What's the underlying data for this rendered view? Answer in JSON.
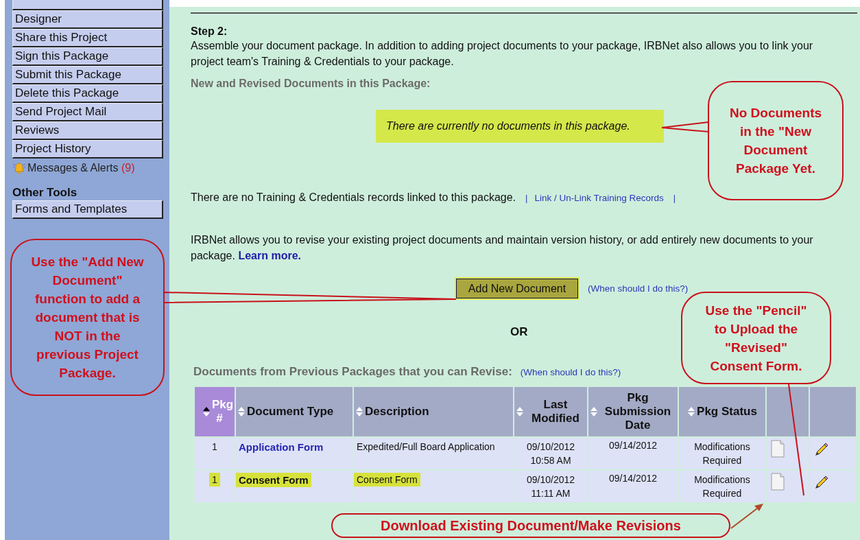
{
  "sidebar": {
    "items": [
      {
        "label": "Designer"
      },
      {
        "label": "Share this Project"
      },
      {
        "label": "Sign this Package"
      },
      {
        "label": "Submit this Package"
      },
      {
        "label": "Delete this Package"
      },
      {
        "label": "Send Project Mail"
      },
      {
        "label": "Reviews"
      },
      {
        "label": "Project History"
      }
    ],
    "messages": {
      "label": "Messages & Alerts",
      "count": "(9)"
    },
    "other_tools": {
      "heading": "Other Tools",
      "items": [
        {
          "label": "Forms and Templates"
        }
      ]
    }
  },
  "main": {
    "step_title": "Step 2:",
    "intro": "Assemble your document package. In addition to adding project documents to your package, IRBNet also allows you to link your project team's Training & Credentials to your package.",
    "new_docs_heading": "New and Revised Documents in this Package:",
    "empty_message": "There are currently no documents in this package.",
    "training_text": "There are no Training & Credentials records linked to this package.",
    "training_separators": [
      "|",
      "|"
    ],
    "training_link": "Link / Un-Link Training Records",
    "revise_text": "IRBNet allows you to revise your existing project documents and maintain version history, or add entirely new documents to your package.",
    "learn_more": "Learn more.",
    "add_button": "Add New Document",
    "add_help": "(When should I do this?)",
    "or": "OR",
    "prev_heading": "Documents from Previous Packages that you can Revise:",
    "prev_help": "(When should I do this?)"
  },
  "table": {
    "columns": [
      {
        "label": "Pkg #",
        "sorted": true
      },
      {
        "label": "Document Type",
        "sorted": false
      },
      {
        "label": "Description",
        "sorted": false
      },
      {
        "label": "Last Modified",
        "sorted": false
      },
      {
        "label": "Pkg Submission Date",
        "sorted": false
      },
      {
        "label": "Pkg Status",
        "sorted": false
      }
    ],
    "rows": [
      {
        "pkg": "1",
        "type": "Application Form",
        "description": "Expedited/Full Board Application",
        "last_modified": "09/10/2012 10:58 AM",
        "submitted": "09/14/2012",
        "status": "Modifications Required",
        "highlighted": false
      },
      {
        "pkg": "1",
        "type": "Consent Form",
        "description": "Consent Form",
        "last_modified": "09/10/2012 11:11 AM",
        "submitted": "09/14/2012",
        "status": "Modifications Required",
        "highlighted": true
      }
    ]
  },
  "callouts": [
    {
      "text": "No Documents in the \"New Document Package Yet."
    },
    {
      "text": "Use the \"Add New Document\" function to add a document that is NOT in the previous Project Package."
    },
    {
      "text": "Use the \"Pencil\" to Upload the \"Revised\" Consent Form."
    },
    {
      "text": "Download Existing Document/Make Revisions"
    }
  ]
}
